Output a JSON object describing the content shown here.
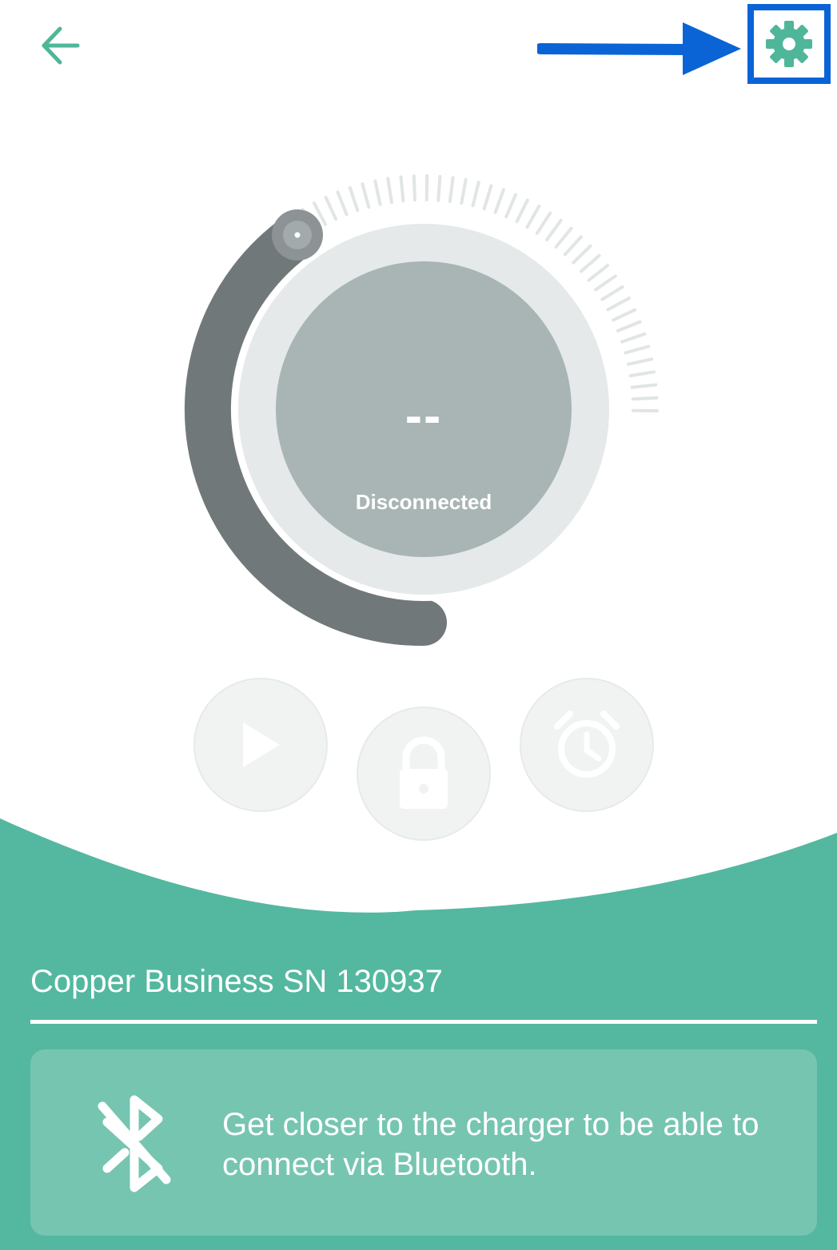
{
  "header": {
    "back_icon": "arrow-left-icon",
    "settings_icon": "gear-icon",
    "accent_color": "#4fb69a",
    "highlight_color": "#0a64d6"
  },
  "dial": {
    "value": "--",
    "status": "Disconnected"
  },
  "actions": [
    {
      "name": "play",
      "icon": "play-icon"
    },
    {
      "name": "lock",
      "icon": "lock-icon"
    },
    {
      "name": "alarm",
      "icon": "alarm-clock-icon"
    }
  ],
  "charger": {
    "name": "Copper Business SN 130937"
  },
  "info_card": {
    "icon": "bluetooth-disabled-icon",
    "message": "Get closer to the charger to be able to connect via Bluetooth."
  },
  "colors": {
    "green": "#53b89f",
    "card": "#76c5b0",
    "dial_track": "#717879",
    "dial_center": "#a9b5b5"
  }
}
